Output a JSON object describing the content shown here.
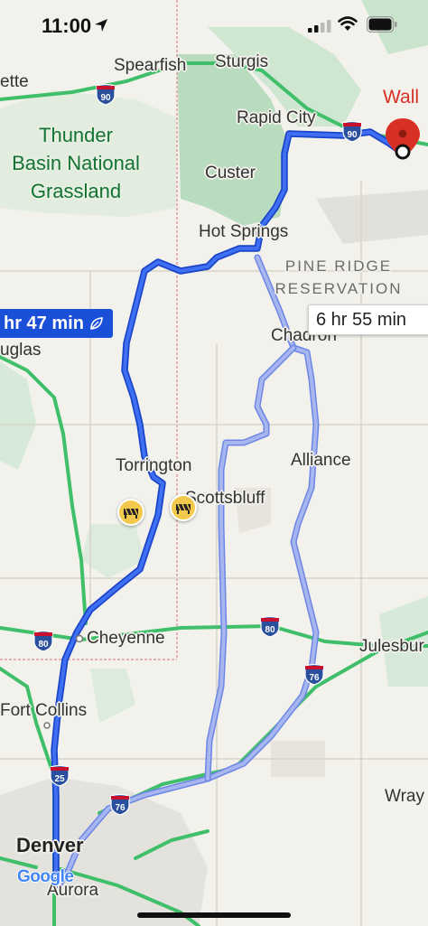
{
  "status_bar": {
    "time": "11:00"
  },
  "map": {
    "destination": {
      "name": "Wall"
    },
    "cities": {
      "spearfish": "Spearfish",
      "sturgis": "Sturgis",
      "belle_fourche_partial": "ette",
      "rapid_city": "Rapid City",
      "custer": "Custer",
      "hot_springs": "Hot Springs",
      "chadron": "Chadron",
      "douglas_partial": "uglas",
      "torrington": "Torrington",
      "scottsbluff": "Scottsbluff",
      "alliance": "Alliance",
      "cheyenne": "Cheyenne",
      "julesburg": "Julesbur",
      "fort_collins": "Fort Collins",
      "wray": "Wray",
      "denver": "Denver",
      "aurora": "Aurora"
    },
    "park_label": "Thunder Basin National Grassland",
    "park_lines": [
      "Thunder",
      "Basin National",
      "Grassland"
    ],
    "reservation_lines": [
      "PINE RIDGE",
      "RESERVATION"
    ],
    "highways": {
      "i90_west": "90",
      "i90_east": "90",
      "i80_west": "80",
      "i80_east": "80",
      "i76_east": "76",
      "i76_west": "76",
      "i25": "25"
    },
    "routes": {
      "primary_time": "hr 47 min",
      "alternate_time": "6 hr 55 min"
    },
    "attribution": "Google",
    "colors": {
      "primary_route": "#1a4fd8",
      "alternate_route": "#a7b6ef",
      "highway": "#3fbf6a",
      "destination_pin": "#d93025",
      "park": "#c9e3cc"
    }
  }
}
